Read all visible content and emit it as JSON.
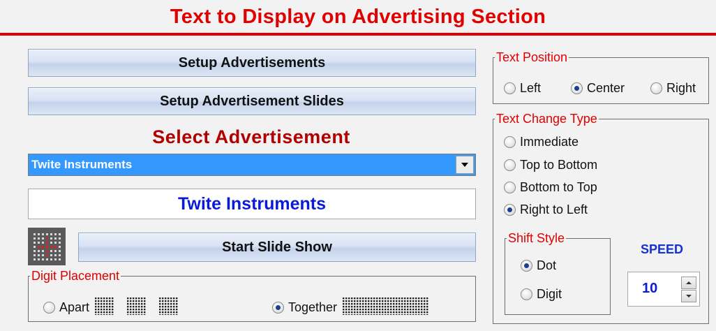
{
  "header": {
    "title": "Text to Display on Advertising Section"
  },
  "buttons": {
    "setup_ads": "Setup Advertisements",
    "setup_slides": "Setup Advertisement Slides",
    "start_show": "Start Slide Show"
  },
  "select": {
    "label": "Select Advertisement",
    "selected": "Twite Instruments"
  },
  "display_text": "Twite Instruments",
  "digit_placement": {
    "legend": "Digit Placement",
    "options": [
      {
        "label": "Apart",
        "checked": false
      },
      {
        "label": "Together",
        "checked": true
      }
    ]
  },
  "text_position": {
    "legend": "Text Position",
    "options": [
      {
        "label": "Left",
        "checked": false
      },
      {
        "label": "Center",
        "checked": true
      },
      {
        "label": "Right",
        "checked": false
      }
    ]
  },
  "text_change_type": {
    "legend": "Text Change Type",
    "options": [
      {
        "label": "Immediate",
        "checked": false
      },
      {
        "label": "Top to Bottom",
        "checked": false
      },
      {
        "label": "Bottom to Top",
        "checked": false
      },
      {
        "label": "Right to Left",
        "checked": true
      }
    ]
  },
  "shift_style": {
    "legend": "Shift Style",
    "options": [
      {
        "label": "Dot",
        "checked": true
      },
      {
        "label": "Digit",
        "checked": false
      }
    ]
  },
  "speed": {
    "label": "SPEED",
    "value": "10"
  },
  "colors": {
    "title_red": "#e00000",
    "select_label": "#b00000",
    "combo_highlight": "#3399ff",
    "display_blue": "#0a1bd8",
    "speed_blue": "#1430d0"
  },
  "icons": {
    "grid": "led-grid-icon",
    "dropdown": "chevron-down-icon",
    "spin_up": "arrow-up-icon",
    "spin_down": "arrow-down-icon"
  }
}
